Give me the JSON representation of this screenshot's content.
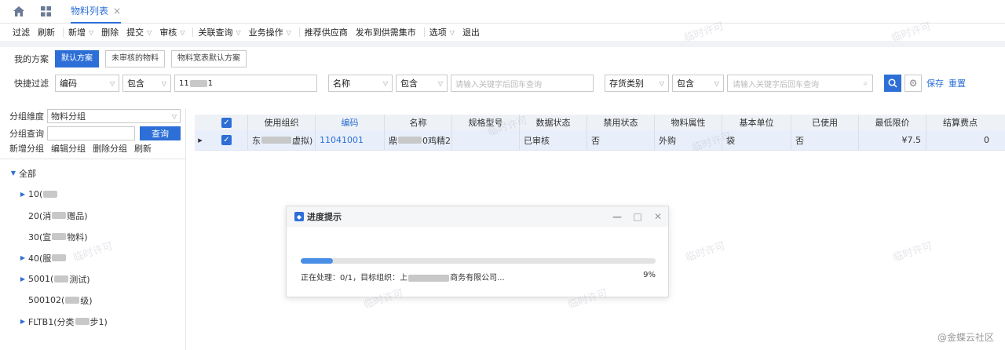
{
  "tabs": {
    "active_label": "物料列表",
    "close_glyph": "×"
  },
  "toolbar": {
    "items": [
      {
        "label": "过滤",
        "caret": false,
        "sep": false
      },
      {
        "label": "刷新",
        "caret": false,
        "sep": true
      },
      {
        "label": "新增",
        "caret": true,
        "sep": false
      },
      {
        "label": "删除",
        "caret": false,
        "sep": false
      },
      {
        "label": "提交",
        "caret": true,
        "sep": false
      },
      {
        "label": "审核",
        "caret": true,
        "sep": true
      },
      {
        "label": "关联查询",
        "caret": true,
        "sep": false
      },
      {
        "label": "业务操作",
        "caret": true,
        "sep": true
      },
      {
        "label": "推荐供应商",
        "caret": false,
        "sep": false
      },
      {
        "label": "发布到供需集市",
        "caret": false,
        "sep": true
      },
      {
        "label": "选项",
        "caret": true,
        "sep": false
      },
      {
        "label": "退出",
        "caret": false,
        "sep": false
      }
    ]
  },
  "scheme": {
    "label": "我的方案",
    "options": [
      "默认方案",
      "未审核的物料",
      "物料宽表默认方案"
    ]
  },
  "filter": {
    "label": "快捷过滤",
    "field1": "编码",
    "op1": "包含",
    "value1_prefix": "11",
    "value1_suffix": "1",
    "field2": "名称",
    "op2": "包含",
    "placeholder2": "请输入关键字后回车查询",
    "field3": "存货类别",
    "op3": "包含",
    "placeholder3": "请输入关键字后回车查询",
    "save": "保存",
    "reset": "重置"
  },
  "left": {
    "dim_label": "分组维度",
    "dim_value": "物料分组",
    "query_label": "分组查询",
    "query_btn": "查询",
    "ops": [
      "新增分组",
      "编辑分组",
      "删除分组",
      "刷新"
    ],
    "tree_root": "全部",
    "nodes": [
      {
        "pre": "10(",
        "post": "",
        "arrow": true
      },
      {
        "pre": "20(消",
        "post": "赠品)",
        "arrow": false
      },
      {
        "pre": "30(宣",
        "post": "物料)",
        "arrow": false
      },
      {
        "pre": "40(服",
        "post": "",
        "arrow": true
      },
      {
        "pre": "5001(",
        "post": "测试)",
        "arrow": true
      },
      {
        "pre": "500102(",
        "post": "级)",
        "arrow": false
      },
      {
        "pre": "FLTB1(分类",
        "post": "步1)",
        "arrow": true
      }
    ]
  },
  "grid": {
    "headers": [
      "使用组织",
      "编码",
      "名称",
      "规格型号",
      "数据状态",
      "禁用状态",
      "物料属性",
      "基本单位",
      "已使用",
      "最低限价",
      "结算费点"
    ],
    "row": {
      "org_pre": "东",
      "org_post": "虚拟)",
      "code": "11041001",
      "name_pre": "鼎",
      "name_post": "0鸡精2",
      "spec": "",
      "status": "已审核",
      "disabled": "否",
      "attr": "外购",
      "unit": "袋",
      "used": "否",
      "min_price": "¥7.5",
      "fee": "0"
    }
  },
  "modal": {
    "title": "进度提示",
    "progress": 0.09,
    "text_pre": "正在处理：0/1，目标组织：上",
    "text_post": "商务有限公司...",
    "percent": "9%"
  },
  "watermark": "临时许可",
  "footer": "@金蝶云社区",
  "colors": {
    "accent": "#2d6fd6",
    "header_bg": "#eef1f6",
    "row_bg": "#e8effa"
  }
}
